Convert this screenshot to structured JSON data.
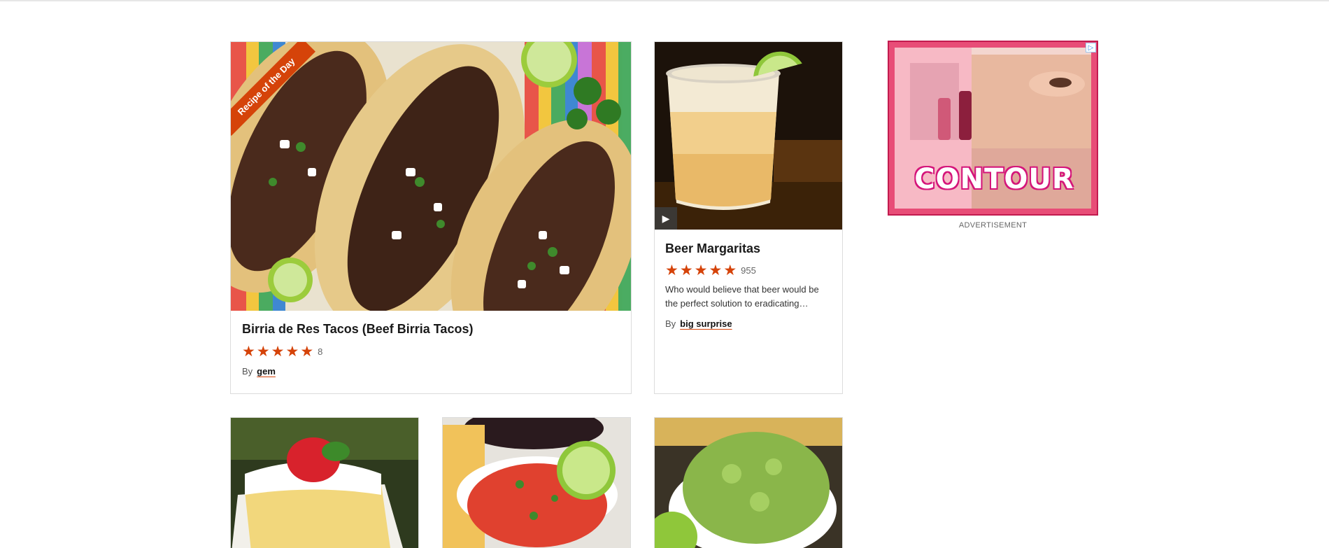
{
  "featured": {
    "badge": "Recipe of the Day",
    "title": "Birria de Res Tacos (Beef Birria Tacos)",
    "rating": 5,
    "review_count": "8",
    "by_label": "By",
    "author": "gem"
  },
  "card2": {
    "title": "Beer Margaritas",
    "rating": 5,
    "review_count": "955",
    "description": "Who would believe that beer would be the perfect solution to eradicating…",
    "by_label": "By",
    "author": "big surprise",
    "play_icon": "play-icon"
  },
  "ad": {
    "headline": "CONTOUR",
    "label": "ADVERTISEMENT",
    "adchoices_icon": "adchoices-icon"
  },
  "colors": {
    "accent": "#d54309",
    "ad_border": "#c21b4f"
  }
}
